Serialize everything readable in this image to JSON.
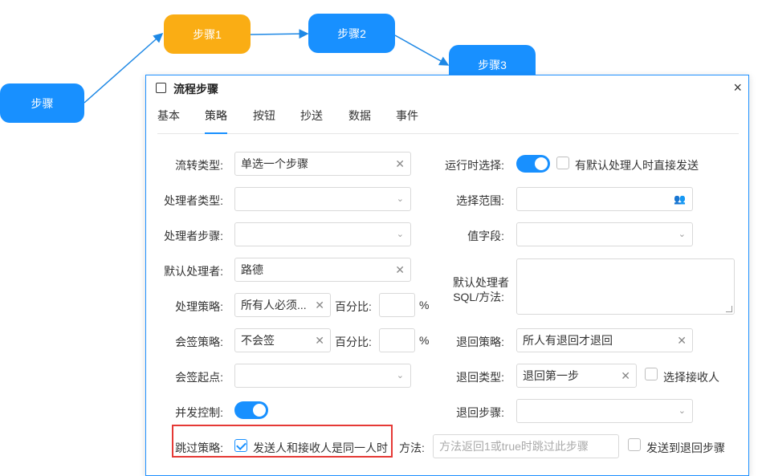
{
  "canvas": {
    "nodes": {
      "start": "步骤",
      "step1": "步骤1",
      "step2": "步骤2",
      "step3": "步骤3"
    },
    "colors": {
      "node_blue": "#1890ff",
      "node_orange": "#faad14",
      "edge": "#1e88e5"
    }
  },
  "dialog": {
    "title": "流程步骤",
    "close_icon": "×",
    "tabs": [
      "基本",
      "策略",
      "按钮",
      "抄送",
      "数据",
      "事件"
    ],
    "active_tab": "策略"
  },
  "form": {
    "flow_type": {
      "label": "流转类型:",
      "value": "单选一个步骤"
    },
    "handler_type": {
      "label": "处理者类型:",
      "value": ""
    },
    "handler_step": {
      "label": "处理者步骤:",
      "value": ""
    },
    "default_handler": {
      "label": "默认处理者:",
      "value": "路德"
    },
    "handle_policy": {
      "label": "处理策略:",
      "value": "所有人必须...",
      "percent_label": "百分比:",
      "percent_value": "",
      "unit": "%"
    },
    "countersign_policy": {
      "label": "会签策略:",
      "value": "不会签",
      "percent_label": "百分比:",
      "percent_value": "",
      "unit": "%"
    },
    "countersign_start": {
      "label": "会签起点:",
      "value": ""
    },
    "concurrency": {
      "label": "并发控制:",
      "on": true
    },
    "skip_policy": {
      "label": "跳过策略:",
      "checkbox_label": "发送人和接收人是同一人时",
      "checked": true
    },
    "method": {
      "label": "方法:",
      "placeholder": "方法返回1或true时跳过此步骤",
      "send_back_label": "发送到退回步骤",
      "send_back_checked": false
    },
    "runtime_select": {
      "label": "运行时选择:",
      "on": true,
      "auto_send_label": "有默认处理人时直接发送",
      "auto_send_checked": false
    },
    "select_scope": {
      "label": "选择范围:",
      "value": ""
    },
    "value_field": {
      "label": "值字段:",
      "value": ""
    },
    "default_handler_sql": {
      "label_line1": "默认处理者",
      "label_line2": "SQL/方法:",
      "value": ""
    },
    "return_policy": {
      "label": "退回策略:",
      "value": "所人有退回才退回"
    },
    "return_type": {
      "label": "退回类型:",
      "value": "退回第一步",
      "select_receiver_label": "选择接收人",
      "select_receiver_checked": false
    },
    "return_step": {
      "label": "退回步骤:",
      "value": ""
    }
  }
}
